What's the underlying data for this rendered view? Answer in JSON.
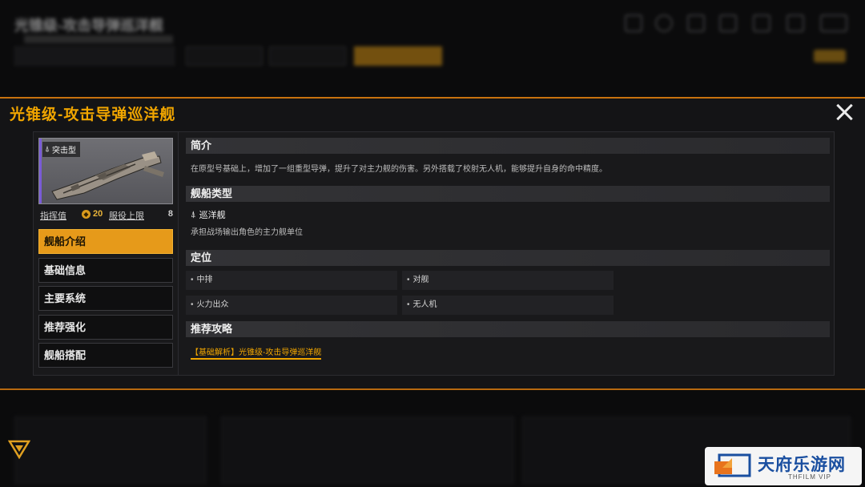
{
  "modal": {
    "title": "光锥级-攻击导弹巡洋舰"
  },
  "ship": {
    "class_label": "突击型",
    "command_label": "指挥值",
    "command_value": "20",
    "service_limit_label": "服役上限",
    "service_limit_value": "8"
  },
  "nav": {
    "items": [
      {
        "label": "舰船介绍",
        "active": true
      },
      {
        "label": "基础信息",
        "active": false
      },
      {
        "label": "主要系统",
        "active": false
      },
      {
        "label": "推荐强化",
        "active": false
      },
      {
        "label": "舰船搭配",
        "active": false
      }
    ]
  },
  "content": {
    "intro": {
      "header": "简介",
      "text": "在原型号基础上，增加了一组重型导弹，提升了对主力舰的伤害。另外搭载了校射无人机，能够提升自身的命中精度。"
    },
    "ship_type": {
      "header": "舰船类型",
      "type_name": "巡洋舰",
      "description": "承担战场输出角色的主力舰单位"
    },
    "positioning": {
      "header": "定位",
      "tags": [
        "中排",
        "对舰",
        "火力出众",
        "无人机"
      ]
    },
    "guide": {
      "header": "推荐攻略",
      "link": "【基础解析】光锥级-攻击导弹巡洋舰"
    }
  },
  "colors": {
    "accent": "#f0a500",
    "active_tab": "#e69a1a",
    "modal_bg": "#141416"
  },
  "watermark": {
    "name": "天府乐游网",
    "sub": "THFILM VIP"
  }
}
